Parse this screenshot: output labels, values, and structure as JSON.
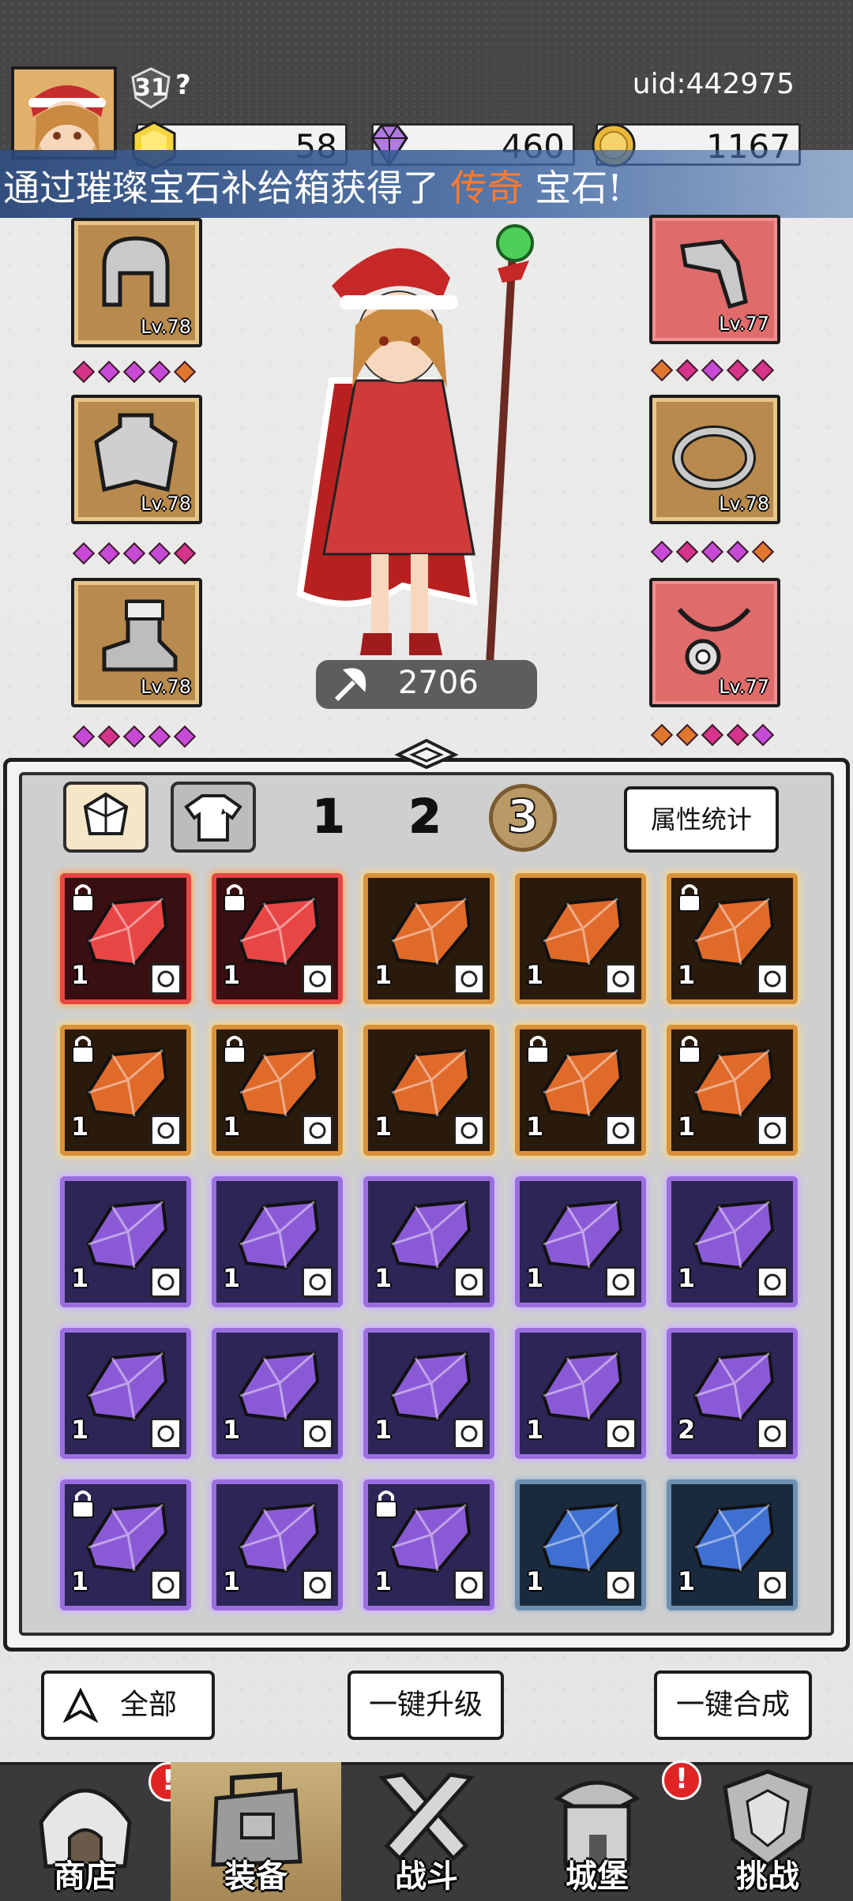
{
  "header": {
    "player_level": "31",
    "help_mark": "?",
    "uid": "uid:442975",
    "currencies": [
      {
        "name": "gold-gem-icon",
        "value": "58"
      },
      {
        "name": "diamond-icon",
        "value": "460"
      },
      {
        "name": "coin-icon",
        "value": "1167"
      }
    ]
  },
  "banner": {
    "prefix": "通过璀璨宝石补给箱获得了",
    "highlight": "传奇",
    "suffix": "宝石!",
    "highlight_color": "#ff7a2e"
  },
  "equipment": {
    "left": [
      {
        "item": "helmet-icon",
        "level": "Lv.78",
        "frame": "bronze"
      },
      {
        "item": "cape-armor-icon",
        "level": "Lv.78",
        "frame": "bronze"
      },
      {
        "item": "boot-icon",
        "level": "Lv.78",
        "frame": "bronze"
      }
    ],
    "right": [
      {
        "item": "bracer-icon",
        "level": "Lv.77",
        "frame": "red"
      },
      {
        "item": "ring-icon",
        "level": "Lv.78",
        "frame": "bronze"
      },
      {
        "item": "necklace-icon",
        "level": "Lv.77",
        "frame": "red"
      }
    ]
  },
  "hero": {
    "power": "2706"
  },
  "inventory": {
    "tabs": [
      {
        "name": "gem-tab-icon",
        "active": true
      },
      {
        "name": "shirt-tab-icon",
        "active": false
      }
    ],
    "pages": [
      "1",
      "2",
      "3"
    ],
    "active_page": "3",
    "stats_button": "属性统计",
    "gems": [
      {
        "color": "red",
        "qty": "1",
        "locked": true,
        "slot_icon": "cape-icon"
      },
      {
        "color": "red",
        "qty": "1",
        "locked": true,
        "slot_icon": "boot-icon"
      },
      {
        "color": "orange",
        "qty": "1",
        "locked": false,
        "slot_icon": "helmet-icon"
      },
      {
        "color": "orange",
        "qty": "1",
        "locked": false,
        "slot_icon": "boot-icon"
      },
      {
        "color": "orange",
        "qty": "1",
        "locked": true,
        "slot_icon": "weapon-icon"
      },
      {
        "color": "orange",
        "qty": "1",
        "locked": true,
        "slot_icon": "weapon-icon"
      },
      {
        "color": "orange",
        "qty": "1",
        "locked": true,
        "slot_icon": "ring-icon"
      },
      {
        "color": "orange",
        "qty": "1",
        "locked": false,
        "slot_icon": "ring-icon"
      },
      {
        "color": "orange",
        "qty": "1",
        "locked": true,
        "slot_icon": "ring-icon"
      },
      {
        "color": "orange",
        "qty": "1",
        "locked": true,
        "slot_icon": "ring-icon"
      },
      {
        "color": "purple",
        "qty": "1",
        "locked": false,
        "slot_icon": "helmet-icon"
      },
      {
        "color": "purple",
        "qty": "1",
        "locked": false,
        "slot_icon": "cape-icon"
      },
      {
        "color": "purple",
        "qty": "1",
        "locked": false,
        "slot_icon": "boot-icon"
      },
      {
        "color": "purple",
        "qty": "1",
        "locked": false,
        "slot_icon": "boot-icon"
      },
      {
        "color": "purple",
        "qty": "1",
        "locked": false,
        "slot_icon": "weapon-icon"
      },
      {
        "color": "purple",
        "qty": "1",
        "locked": false,
        "slot_icon": "weapon-icon"
      },
      {
        "color": "purple",
        "qty": "1",
        "locked": false,
        "slot_icon": "weapon-icon"
      },
      {
        "color": "purple",
        "qty": "1",
        "locked": false,
        "slot_icon": "ring-icon"
      },
      {
        "color": "purple",
        "qty": "1",
        "locked": false,
        "slot_icon": "ring-icon"
      },
      {
        "color": "purple",
        "qty": "2",
        "locked": false,
        "slot_icon": "necklace-icon"
      },
      {
        "color": "purple",
        "qty": "1",
        "locked": true,
        "slot_icon": "necklace-icon"
      },
      {
        "color": "purple",
        "qty": "1",
        "locked": false,
        "slot_icon": "necklace-icon"
      },
      {
        "color": "purple",
        "qty": "1",
        "locked": true,
        "slot_icon": "necklace-icon"
      },
      {
        "color": "blue",
        "qty": "1",
        "locked": false,
        "slot_icon": "helmet-icon"
      },
      {
        "color": "blue",
        "qty": "1",
        "locked": false,
        "slot_icon": "helmet-icon"
      }
    ]
  },
  "actions": {
    "filter_all": "全部",
    "upgrade_all": "一键升级",
    "merge_all": "一键合成"
  },
  "nav": [
    {
      "label": "商店",
      "icon": "shop-hut-icon",
      "active": false,
      "alert": "!"
    },
    {
      "label": "装备",
      "icon": "backpack-icon",
      "active": true,
      "alert": ""
    },
    {
      "label": "战斗",
      "icon": "crossed-swords-icon",
      "active": false,
      "alert": ""
    },
    {
      "label": "城堡",
      "icon": "castle-icon",
      "active": false,
      "alert": "!"
    },
    {
      "label": "挑战",
      "icon": "shield-crest-icon",
      "active": false,
      "alert": ""
    }
  ],
  "colors": {
    "gem_red": "#e84545",
    "gem_orange": "#e06a2a",
    "gem_purple": "#8a5ad6",
    "gem_blue": "#3f6fd0"
  }
}
